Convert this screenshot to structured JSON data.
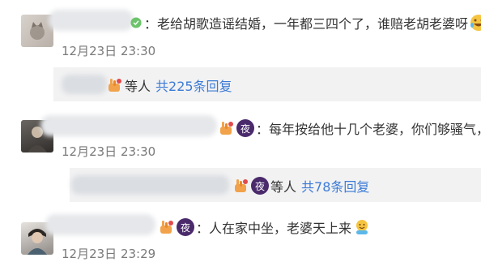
{
  "comments": [
    {
      "text": "：老给胡歌造谣结婚，一年都三四个了，谁赔老胡老婆呀",
      "time": "12月23日 23:30",
      "replies": {
        "suffix": "等人",
        "link": "共225条回复"
      }
    },
    {
      "text": "：每年按给他十几个老婆，你们够骚气，",
      "time": "12月23日 23:30",
      "replies": {
        "suffix": "等人",
        "link": "共78条回复"
      }
    },
    {
      "text": "：人在家中坐，老婆天上来",
      "time": "12月23日 23:29"
    }
  ],
  "badges": {
    "night_label": "夜"
  },
  "colors": {
    "link": "#3c7bd6",
    "time": "#7a7a7a",
    "reply_bg": "#f2f2f3"
  }
}
